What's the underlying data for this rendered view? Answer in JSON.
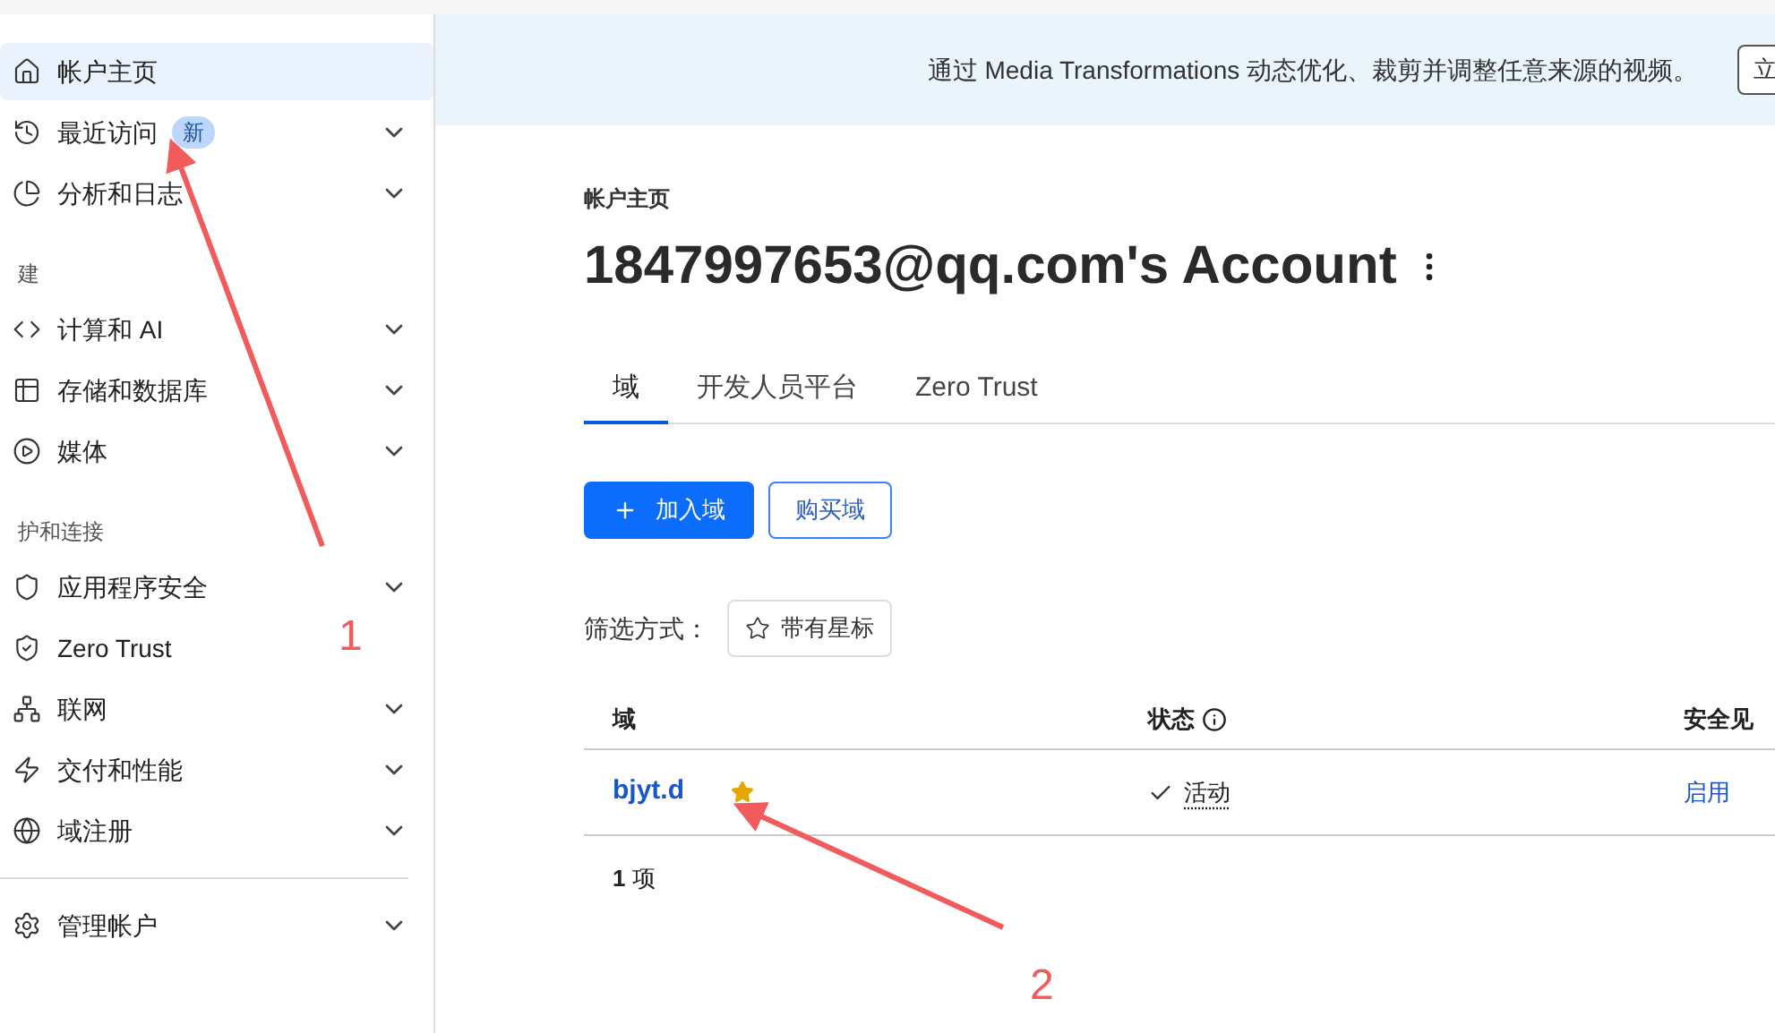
{
  "sidebar": {
    "groups": [
      {
        "items": [
          {
            "label": "帐户主页",
            "selected": true,
            "expandable": false
          },
          {
            "label": "最近访问",
            "selected": false,
            "expandable": true,
            "badge": "新"
          },
          {
            "label": "分析和日志",
            "selected": false,
            "expandable": true
          }
        ]
      },
      {
        "heading": "建",
        "items": [
          {
            "label": "计算和 AI",
            "selected": false,
            "expandable": true
          },
          {
            "label": "存储和数据库",
            "selected": false,
            "expandable": true
          },
          {
            "label": "媒体",
            "selected": false,
            "expandable": true
          }
        ]
      },
      {
        "heading": "护和连接",
        "items": [
          {
            "label": "应用程序安全",
            "selected": false,
            "expandable": true
          },
          {
            "label": "Zero Trust",
            "selected": false,
            "expandable": false
          },
          {
            "label": "联网",
            "selected": false,
            "expandable": true
          },
          {
            "label": "交付和性能",
            "selected": false,
            "expandable": true
          },
          {
            "label": "域注册",
            "selected": false,
            "expandable": true
          }
        ]
      },
      {
        "divider": true,
        "items": [
          {
            "label": "管理帐户",
            "selected": false,
            "expandable": true
          }
        ]
      }
    ]
  },
  "banner": {
    "text": "通过 Media Transformations 动态优化、裁剪并调整任意来源的视频。",
    "button": "立"
  },
  "breadcrumb": "帐户主页",
  "title": "1847997653@qq.com's Account",
  "tabs": [
    {
      "label": "域",
      "selected": true
    },
    {
      "label": "开发人员平台",
      "selected": false
    },
    {
      "label": "Zero Trust",
      "selected": false
    }
  ],
  "actions": {
    "primary": "加入域",
    "secondary": "购买域"
  },
  "filter": {
    "label": "筛选方式：",
    "chip": "带有星标"
  },
  "table": {
    "columns": [
      "域",
      "状态",
      "安全见"
    ],
    "rows": [
      {
        "domain": "bjyt.d",
        "starred": true,
        "status": "活动",
        "insight": "启用"
      }
    ],
    "footer_count": "1",
    "footer_unit": "项"
  },
  "annotations": [
    {
      "label": "1"
    },
    {
      "label": "2"
    }
  ]
}
